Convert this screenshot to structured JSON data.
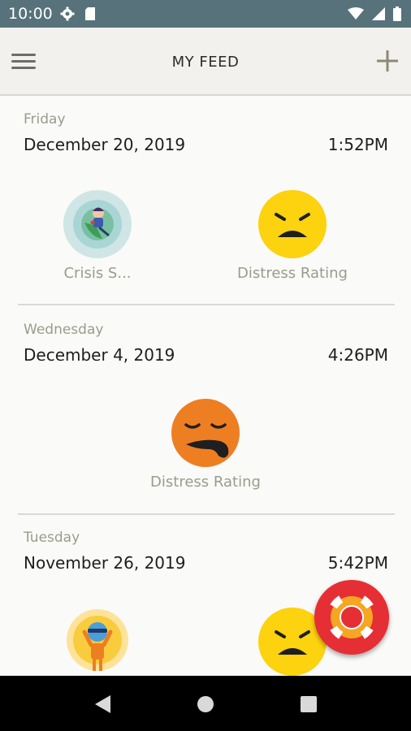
{
  "status_bar": {
    "time": "10:00",
    "left_icons": [
      "gear-icon",
      "sd-card-icon"
    ],
    "right_icons": [
      "wifi-icon",
      "cell-signal-icon",
      "battery-icon"
    ]
  },
  "header": {
    "title": "MY FEED",
    "menu_icon": "hamburger-menu-icon",
    "add_icon": "plus-icon"
  },
  "feed": [
    {
      "day": "Friday",
      "date": "December 20, 2019",
      "time": "1:52PM",
      "items": [
        {
          "label": "Crisis S...",
          "icon": "crisis-support-icon"
        },
        {
          "label": "Distress Rating",
          "icon": "sad-face-yellow-icon"
        }
      ]
    },
    {
      "day": "Wednesday",
      "date": "December 4, 2019",
      "time": "4:26PM",
      "items": [
        {
          "label": "Distress Rating",
          "icon": "drooling-face-orange-icon"
        }
      ]
    },
    {
      "day": "Tuesday",
      "date": "November 26, 2019",
      "time": "5:42PM",
      "items": [
        {
          "label": "",
          "icon": "sun-person-icon"
        },
        {
          "label": "",
          "icon": "sad-face-yellow-icon"
        }
      ]
    }
  ],
  "fab": {
    "icon": "lifebuoy-icon"
  },
  "nav_bar": {
    "icons": [
      "back-icon",
      "home-icon",
      "recents-icon"
    ]
  },
  "colors": {
    "status_bar": "#57727a",
    "app_bar": "#f2f1ee",
    "background": "#fafaf8",
    "muted_text": "#9b9b8d",
    "yellow_face": "#fdd20e",
    "orange_face": "#ee7e22",
    "fab": "#e62e35"
  }
}
